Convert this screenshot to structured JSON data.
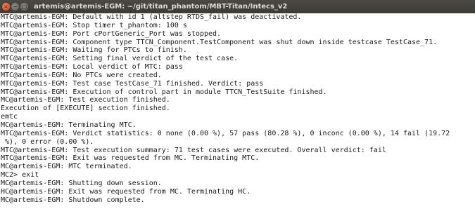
{
  "window": {
    "title": "artemis@artemis-EGM: ~/git/titan_phantom/MBT-Titan/Intecs_v2",
    "buttons": {
      "close_glyph": "×",
      "minimize_glyph": "−",
      "maximize_glyph": "□"
    }
  },
  "terminal": {
    "lines": [
      "MTC@artemis-EGM: Default with id 1 (altstep RTDS_fail) was deactivated.",
      "MTC@artemis-EGM: Stop timer t_phantom: 100 s",
      "MTC@artemis-EGM: Port cPortGeneric_Port was stopped.",
      "MTC@artemis-EGM: Component type TTCN_Component.TestComponent was shut down inside testcase TestCase_71.",
      "MTC@artemis-EGM: Waiting for PTCs to finish.",
      "MTC@artemis-EGM: Setting final verdict of the test case.",
      "MTC@artemis-EGM: Local verdict of MTC: pass",
      "MTC@artemis-EGM: No PTCs were created.",
      "MTC@artemis-EGM: Test case TestCase_71 finished. Verdict: pass",
      "MTC@artemis-EGM: Execution of control part in module TTCN_TestSuite finished.",
      "MC@artemis-EGM: Test execution finished.",
      "Execution of [EXECUTE] section finished.",
      "emtc",
      "MC@artemis-EGM: Terminating MTC.",
      "MTC@artemis-EGM: Verdict statistics: 0 none (0.00 %), 57 pass (80.28 %), 0 inconc (0.00 %), 14 fail (19.72",
      " %), 0 error (0.00 %).",
      "MTC@artemis-EGM: Test execution summary: 71 test cases were executed. Overall verdict: fail",
      "MTC@artemis-EGM: Exit was requested from MC. Terminating MTC.",
      "MC@artemis-EGM: MTC terminated.",
      "MC2> exit",
      "MC@artemis-EGM: Shutting down session.",
      "HC@artemis-EGM: Exit was requested from MC. Terminating HC.",
      "MC@artemis-EGM: Shutdown complete."
    ]
  }
}
